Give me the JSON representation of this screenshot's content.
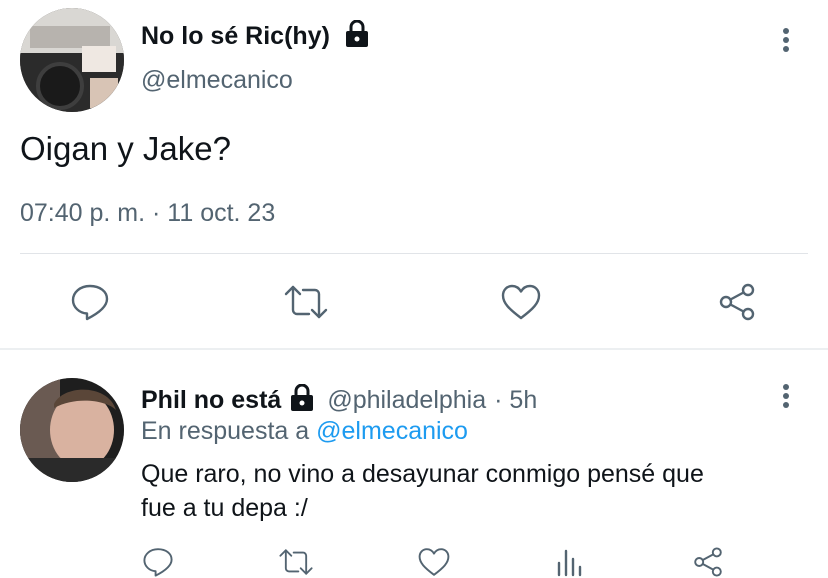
{
  "tweet": {
    "author_name": "No lo sé Ric(hy)",
    "author_handle": "@elmecanico",
    "text": "Oigan y Jake?",
    "timestamp": "07:40 p. m. · 11 oct. 23",
    "actions": [
      "reply-icon",
      "retweet-icon",
      "like-icon",
      "share-icon"
    ]
  },
  "reply": {
    "author_name": "Phil no está",
    "author_handle": "@philadelphia",
    "age": "· 5h",
    "replying_to_prefix": "En respuesta a",
    "replying_to_handle": "@elmecanico",
    "text_line1": "Que raro, no vino a desayunar conmigo pensé que",
    "text_line2": "fue a tu depa :/",
    "actions": [
      "reply-icon",
      "retweet-icon",
      "like-icon",
      "stats-icon",
      "share-icon"
    ]
  },
  "colors": {
    "link": "#1d9bf0",
    "secondary_text": "#536471",
    "primary_text": "#0f1419"
  }
}
